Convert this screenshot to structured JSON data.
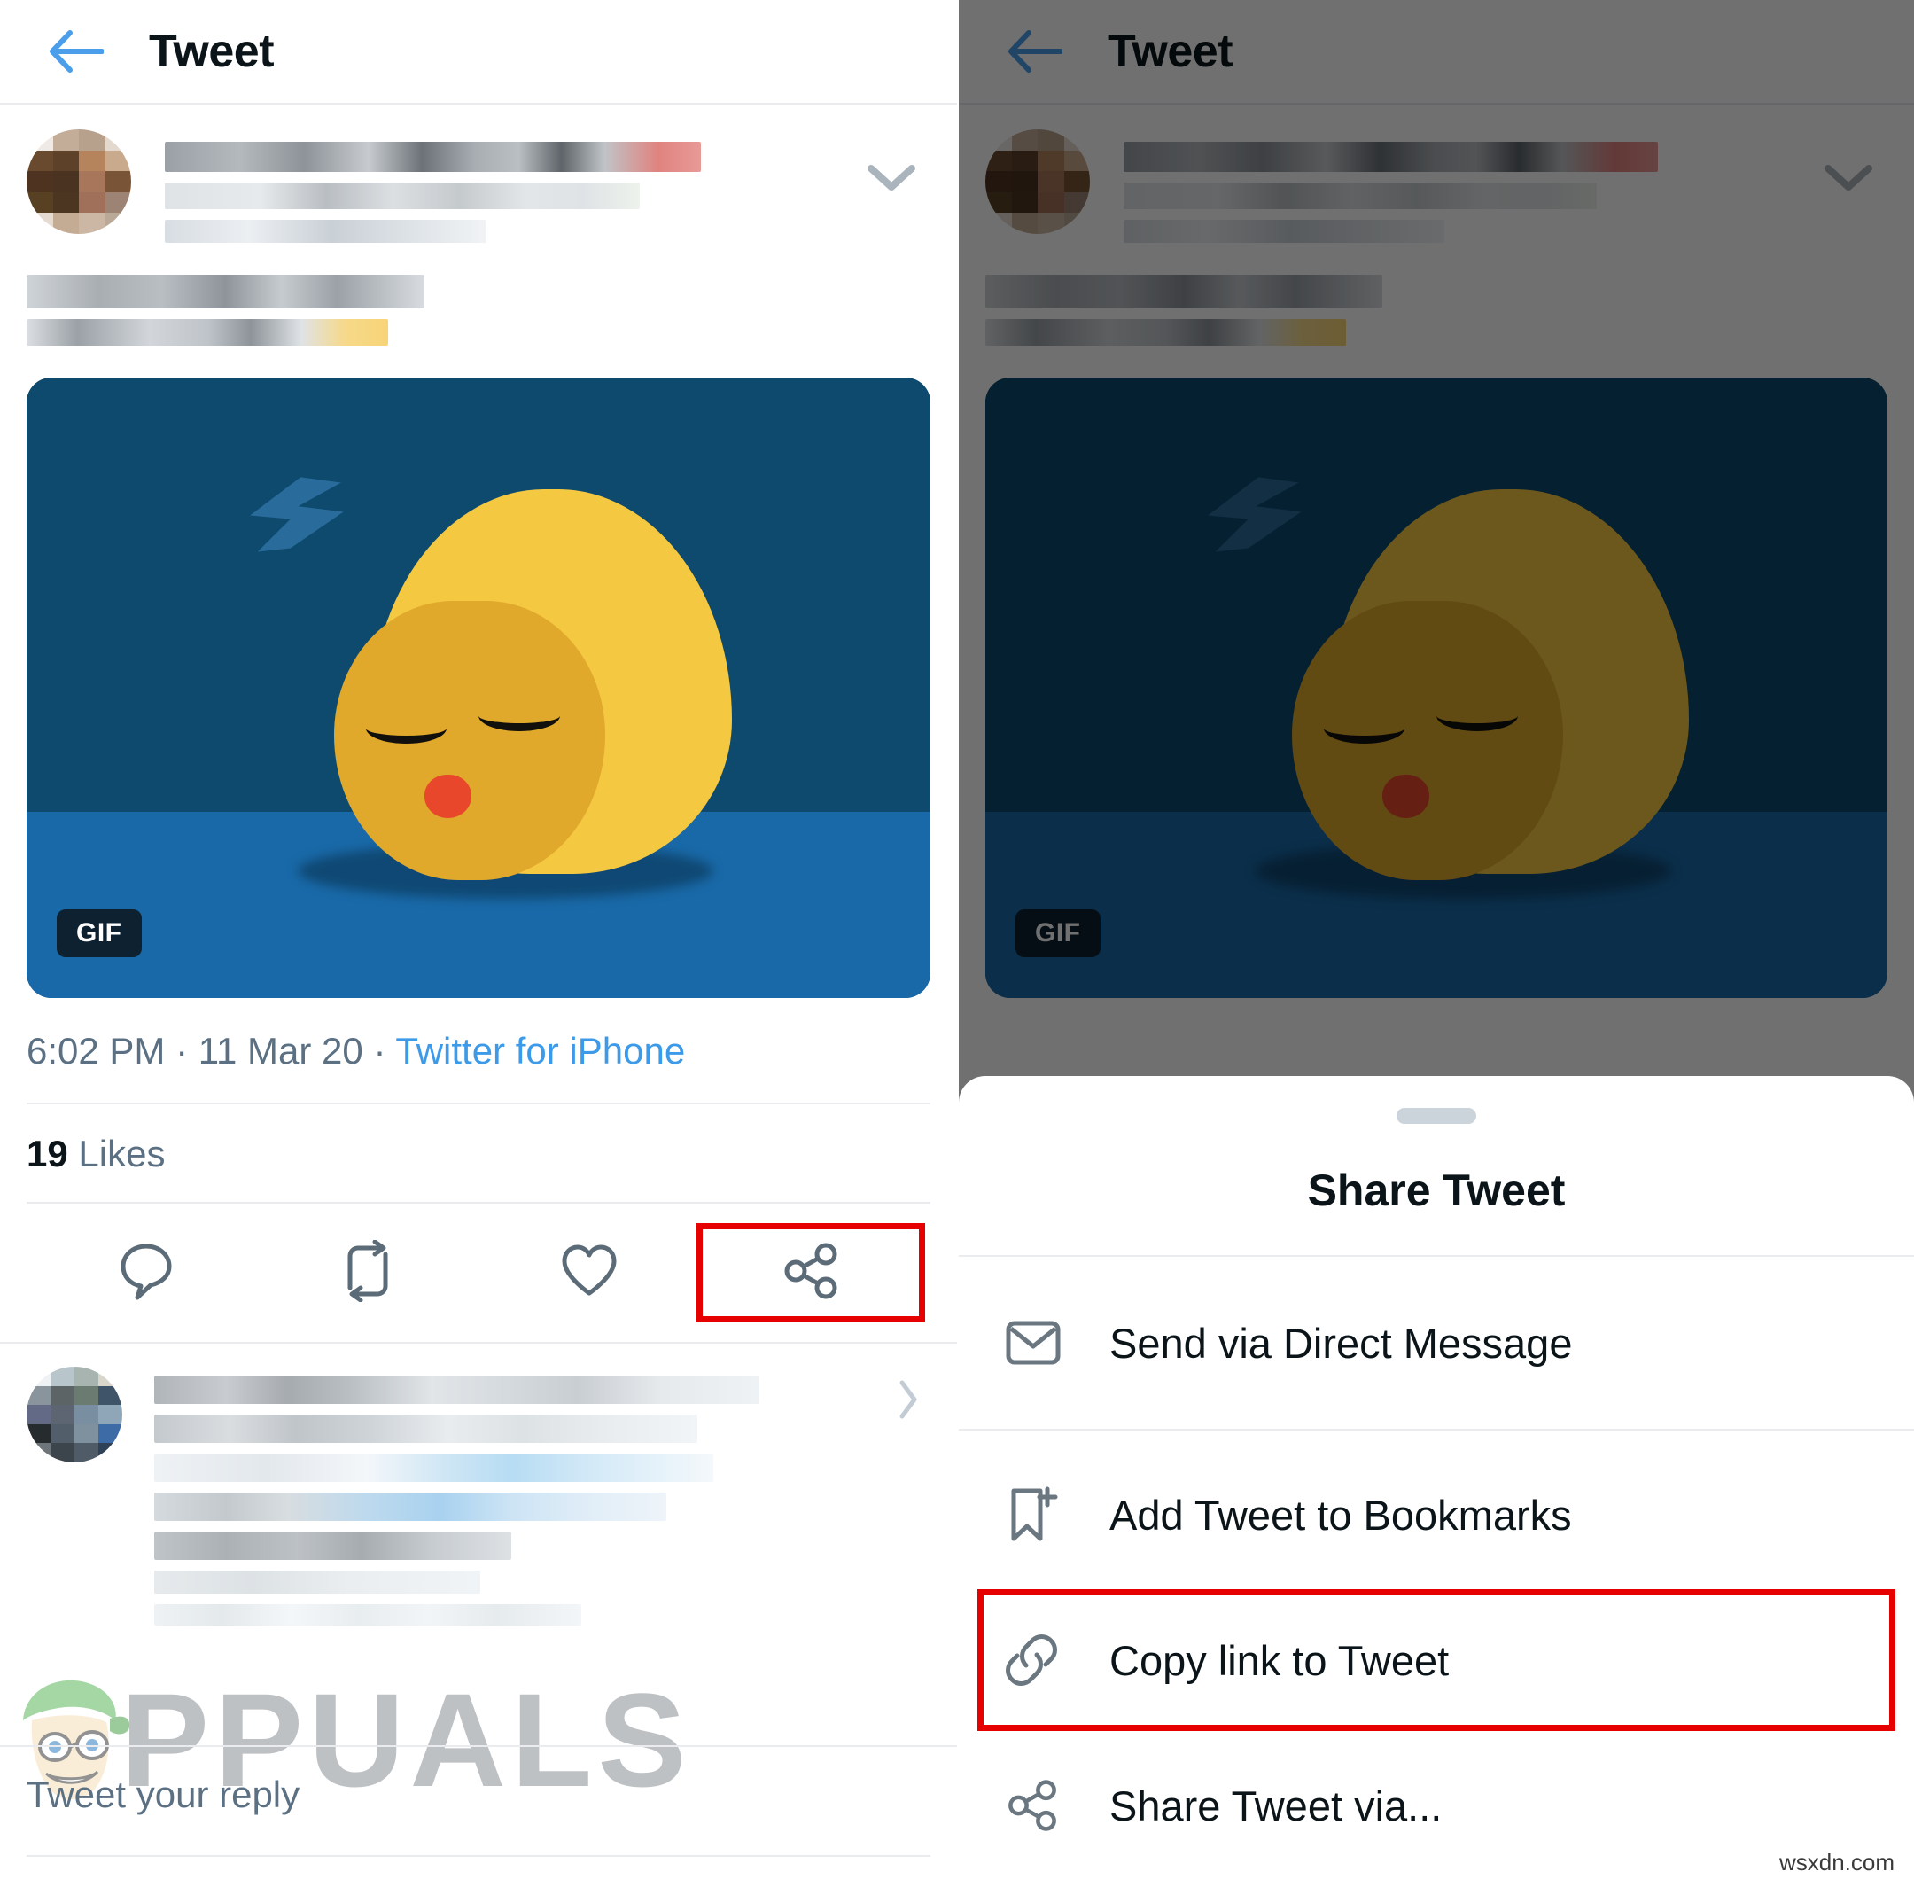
{
  "left_panel": {
    "header": {
      "back_icon": "back-arrow-icon",
      "title": "Tweet"
    },
    "tweet": {
      "author_name_redacted": true,
      "author_handle_redacted": true,
      "more_icon": "chevron-down-icon",
      "body_redacted": true,
      "media": {
        "type": "gif",
        "badge_label": "GIF",
        "description": "sleeping yellow emoji blob with Z zzz on dark blue background",
        "colors": {
          "sky": "#0d4a6e",
          "floor": "#1969a8",
          "blob_light": "#f5c842",
          "blob_dark": "#e0a92c",
          "mouth": "#e8472c",
          "zzz": "#2b6f9e",
          "badge_bg": "#0e2130"
        }
      },
      "meta": {
        "time": "6:02 PM",
        "separator_1": "·",
        "date": "11 Mar 20",
        "separator_2": "·",
        "source": "Twitter for iPhone"
      },
      "stats": {
        "likes_count": "19",
        "likes_label": "Likes"
      },
      "actions": [
        {
          "name": "reply",
          "icon": "comment-icon",
          "highlighted": false
        },
        {
          "name": "retweet",
          "icon": "retweet-icon",
          "highlighted": false
        },
        {
          "name": "like",
          "icon": "heart-icon",
          "highlighted": false
        },
        {
          "name": "share",
          "icon": "share-icon",
          "highlighted": true
        }
      ]
    },
    "reply_thread": {
      "replies_redacted": true
    },
    "composer": {
      "placeholder": "Tweet your reply"
    },
    "watermark": {
      "brand": "PPUALS",
      "brand_full": "APPUALS"
    }
  },
  "right_panel": {
    "header": {
      "back_icon": "back-arrow-icon",
      "title": "Tweet"
    },
    "dimmed": true,
    "media_badge_label": "GIF",
    "share_sheet": {
      "title": "Share Tweet",
      "items": [
        {
          "label": "Send via Direct Message",
          "icon": "envelope-icon",
          "highlighted": false
        },
        {
          "label": "Add Tweet to Bookmarks",
          "icon": "bookmark-plus-icon",
          "highlighted": false
        },
        {
          "label": "Copy link to Tweet",
          "icon": "link-icon",
          "highlighted": true
        },
        {
          "label": "Share Tweet via...",
          "icon": "share-icon",
          "highlighted": false
        }
      ]
    }
  },
  "page_watermark": "wsxdn.com",
  "accent_colors": {
    "twitter_blue": "#3d9ae8",
    "highlight_red": "#e60000",
    "text_primary": "#0b1519",
    "text_secondary": "#5b7083",
    "divider": "#e9ebee"
  }
}
